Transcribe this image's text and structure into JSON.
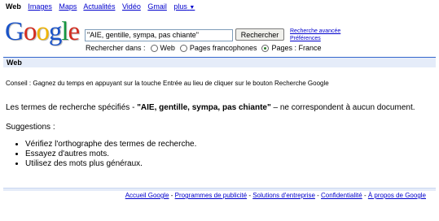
{
  "topnav": {
    "items": [
      "Web",
      "Images",
      "Maps",
      "Actualités",
      "Vidéo",
      "Gmail",
      "plus"
    ],
    "more_arrow": "▼"
  },
  "logo": {
    "letters": [
      "G",
      "o",
      "o",
      "g",
      "l",
      "e"
    ]
  },
  "search": {
    "value": "\"AIE, gentille, sympa, pas chiante\"",
    "button_label": "Rechercher",
    "advanced_link": "Recherche avancée",
    "prefs_link": "Préférences"
  },
  "scope": {
    "label": "Rechercher dans :",
    "options": [
      "Web",
      "Pages francophones",
      "Pages : France"
    ],
    "selected_index": 2
  },
  "bar": {
    "label": "Web"
  },
  "tip": "Conseil : Gagnez du temps en appuyant sur la touche Entrée au lieu de cliquer sur le bouton Recherche Google",
  "results": {
    "prefix": "Les termes de recherche spécifiés - ",
    "query": "\"AIE, gentille, sympa, pas chiante\"",
    "suffix": " – ne correspondent à aucun document."
  },
  "suggestions": {
    "title": "Suggestions :",
    "items": [
      "Vérifiez l'orthographe des termes de recherche.",
      "Essayez d'autres mots.",
      "Utilisez des mots plus généraux."
    ]
  },
  "footer": {
    "links": [
      "Accueil Google",
      "Programmes de publicité",
      "Solutions d'entreprise",
      "Confidentialité",
      "À propos de Google"
    ],
    "separator": " - "
  },
  "colors": {
    "link": "#0000cc",
    "bar_bg": "#e5ecf9",
    "bar_border": "#3366cc"
  }
}
